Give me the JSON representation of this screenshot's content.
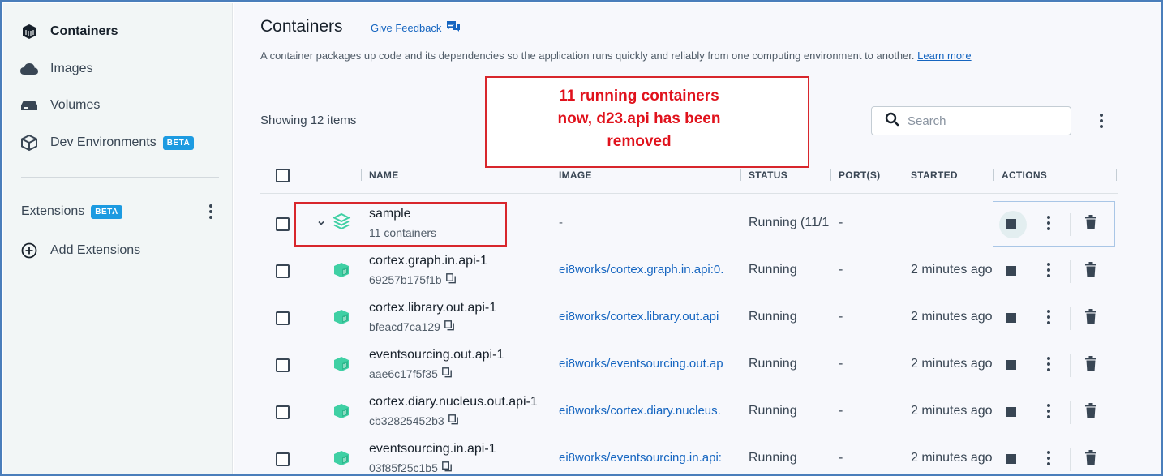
{
  "sidebar": {
    "items": [
      {
        "label": "Containers",
        "icon": "container-icon"
      },
      {
        "label": "Images",
        "icon": "cloud-icon"
      },
      {
        "label": "Volumes",
        "icon": "volume-drive-icon"
      },
      {
        "label": "Dev Environments",
        "icon": "dev-env-cube-icon",
        "badge": "BETA"
      }
    ],
    "extensions": {
      "label": "Extensions",
      "badge": "BETA"
    },
    "add_extensions": {
      "label": "Add Extensions",
      "icon": "plus-circle-icon"
    }
  },
  "header": {
    "title": "Containers",
    "feedback": "Give Feedback",
    "description": "A container packages up code and its dependencies so the application runs quickly and reliably from one computing environment to another.",
    "learn_more": "Learn more"
  },
  "toolbar": {
    "showing": "Showing 12 items",
    "search_placeholder": "Search"
  },
  "annotation": {
    "line1": "11 running containers",
    "line2": "now, d23.api has been",
    "line3": "removed"
  },
  "table": {
    "columns": {
      "name": "NAME",
      "image": "IMAGE",
      "status": "STATUS",
      "ports": "PORT(S)",
      "started": "STARTED",
      "actions": "ACTIONS"
    },
    "group": {
      "name": "sample",
      "sub": "11 containers",
      "image": "-",
      "status": "Running (11/1",
      "port": "-"
    },
    "rows": [
      {
        "name": "cortex.graph.in.api-1",
        "id": "69257b175f1b",
        "image": "ei8works/cortex.graph.in.api:0.",
        "status": "Running",
        "port": "-",
        "started": "2 minutes ago"
      },
      {
        "name": "cortex.library.out.api-1",
        "id": "bfeacd7ca129",
        "image": "ei8works/cortex.library.out.api",
        "status": "Running",
        "port": "-",
        "started": "2 minutes ago"
      },
      {
        "name": "eventsourcing.out.api-1",
        "id": "aae6c17f5f35",
        "image": "ei8works/eventsourcing.out.ap",
        "status": "Running",
        "port": "-",
        "started": "2 minutes ago"
      },
      {
        "name": "cortex.diary.nucleus.out.api-1",
        "id": "cb32825452b3",
        "image": "ei8works/cortex.diary.nucleus.",
        "status": "Running",
        "port": "-",
        "started": "2 minutes ago"
      },
      {
        "name": "eventsourcing.in.api-1",
        "id": "03f85f25c1b5",
        "image": "ei8works/eventsourcing.in.api:",
        "status": "Running",
        "port": "-",
        "started": "2 minutes ago"
      }
    ]
  },
  "colors": {
    "accent": "#1565c0",
    "beta_badge": "#1d9be1",
    "annotation": "#e0121c",
    "container_icon": "#3fd0a4"
  }
}
